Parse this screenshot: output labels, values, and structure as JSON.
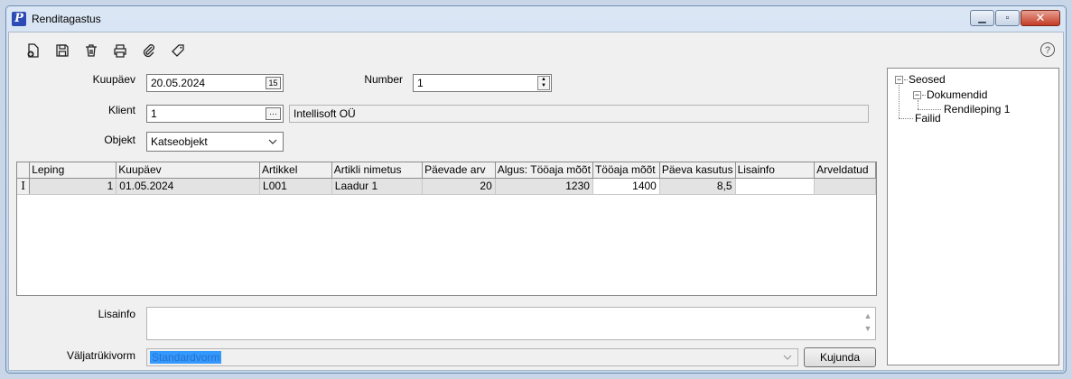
{
  "window": {
    "title": "Renditagastus",
    "app_icon_letter": "P"
  },
  "toolbar": {
    "icons": [
      "new-document-icon",
      "save-icon",
      "delete-icon",
      "print-icon",
      "attach-icon",
      "tag-icon"
    ],
    "help_glyph": "?"
  },
  "form": {
    "kuupaev_label": "Kuupäev",
    "kuupaev_value": "20.05.2024",
    "calendar_glyph": "15",
    "number_label": "Number",
    "number_value": "1",
    "klient_label": "Klient",
    "klient_value": "1",
    "klient_button": "···",
    "klient_name": "Intellisoft OÜ",
    "objekt_label": "Objekt",
    "objekt_value": "Katseobjekt"
  },
  "grid": {
    "columns": [
      "Leping",
      "Kuupäev",
      "Artikkel",
      "Artikli nimetus",
      "Päevade arv",
      "Algus: Tööaja mõõt",
      "Tööaja mõõt",
      "Päeva kasutus",
      "Lisainfo",
      "Arveldatud"
    ],
    "rows": [
      {
        "indicator": "I",
        "cells": [
          "1",
          "01.05.2024",
          "L001",
          "Laadur 1",
          "20",
          "1230",
          "1400",
          "8,5",
          "",
          ""
        ]
      }
    ]
  },
  "tree": {
    "root": "Seosed",
    "documents": "Dokumendid",
    "document_item": "Rendileping 1",
    "files": "Failid",
    "expand_glyph": "−"
  },
  "lisainfo": {
    "label": "Lisainfo",
    "value": ""
  },
  "print_form": {
    "label": "Väljatrükivorm",
    "value": "Standardvorm",
    "button": "Kujunda"
  },
  "colors": {
    "selection": "#3399ff",
    "close_button": "#c43b25"
  }
}
